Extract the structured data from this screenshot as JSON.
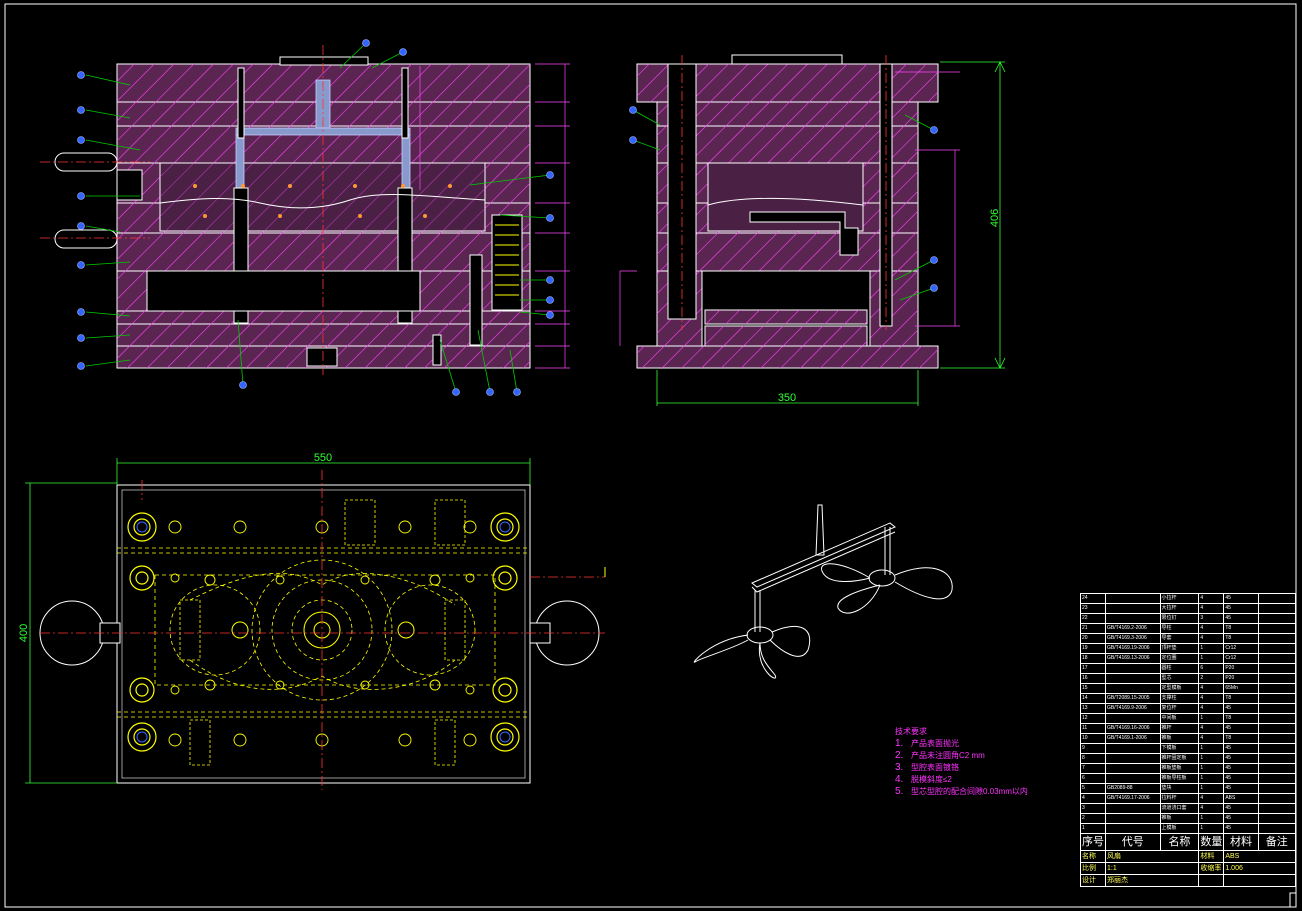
{
  "dimensions": {
    "height_side": "406",
    "width_side": "350",
    "width_top": "550",
    "height_top": "400",
    "small_1": "550",
    "small_2": "406"
  },
  "notes": {
    "heading": "技术要求",
    "items": [
      {
        "num": "1.",
        "text": "产品表面抛光"
      },
      {
        "num": "2.",
        "text": "产品未注圆角C2 mm"
      },
      {
        "num": "3.",
        "text": "型腔表面镀铬"
      },
      {
        "num": "4.",
        "text": "脱模斜度≤2"
      },
      {
        "num": "5.",
        "text": "型芯型腔的配合间隙0.03mm以内"
      }
    ]
  },
  "bom": {
    "header": [
      "序号",
      "代号",
      "名称",
      "数量",
      "材料",
      "备注"
    ],
    "rows": [
      [
        "24",
        "",
        "小拉杆",
        "4",
        "45",
        ""
      ],
      [
        "23",
        "",
        "大拉杆",
        "4",
        "45",
        ""
      ],
      [
        "22",
        "",
        "限位钉",
        "3",
        "45",
        ""
      ],
      [
        "21",
        "GB/T4169.2-2006",
        "导柱",
        "4",
        "T8",
        ""
      ],
      [
        "20",
        "GB/T4169.3-2006",
        "导套",
        "4",
        "T8",
        ""
      ],
      [
        "19",
        "GB/T4169.19-2006",
        "顶杆垫",
        "1",
        "Cr12",
        ""
      ],
      [
        "18",
        "GB/T4169.13-2006",
        "定位圈",
        "1",
        "Cr12",
        ""
      ],
      [
        "17",
        "",
        "圆柱",
        "6",
        "P20",
        ""
      ],
      [
        "16",
        "",
        "型芯",
        "2",
        "P20",
        ""
      ],
      [
        "15",
        "",
        "定型模板",
        "4",
        "65Mn",
        ""
      ],
      [
        "14",
        "GB/T2089.15-2005",
        "支撑柱",
        "4",
        "T8",
        ""
      ],
      [
        "13",
        "GB/T4169.9-2006",
        "复位杆",
        "4",
        "45",
        ""
      ],
      [
        "12",
        "",
        "中间板",
        "1",
        "T8",
        ""
      ],
      [
        "11",
        "GB/T4169.16-2006",
        "推杆",
        "4",
        "45",
        ""
      ],
      [
        "10",
        "GB/T4169.1-2006",
        "推板",
        "4",
        "T8",
        ""
      ],
      [
        "9",
        "",
        "下模板",
        "1",
        "45",
        ""
      ],
      [
        "8",
        "",
        "推杆固定板",
        "1",
        "45",
        ""
      ],
      [
        "7",
        "",
        "推板垫板",
        "1",
        "45",
        ""
      ],
      [
        "6",
        "",
        "推板导柱板",
        "1",
        "45",
        ""
      ],
      [
        "5",
        "GB2089-88",
        "垫块",
        "1",
        "45",
        ""
      ],
      [
        "4",
        "GB/T4169.17-2006",
        "拉料杆",
        "4",
        "ABS",
        ""
      ],
      [
        "3",
        "",
        "流道浇口套",
        "4",
        "45",
        ""
      ],
      [
        "2",
        "",
        "推板",
        "1",
        "45",
        ""
      ],
      [
        "1",
        "",
        "上模板",
        "1",
        "45",
        ""
      ]
    ],
    "title_block": [
      [
        "名称",
        "风扇",
        "材料",
        "ABS"
      ],
      [
        "比例",
        "1:1",
        "收缩率",
        "1.006"
      ],
      [
        "设计",
        "郑丽杰",
        "",
        ""
      ]
    ]
  },
  "colors": {
    "background": "#000000",
    "plate_fill": "#5a2550",
    "hatch": "#ff44ff",
    "outline": "#ffffff",
    "dimension": "#33ff33",
    "balloon": "#3366ff",
    "leader": "#00ff00",
    "center_line": "#ff3333",
    "plan_features": "#ffff00",
    "notes": "#ff33ff"
  }
}
